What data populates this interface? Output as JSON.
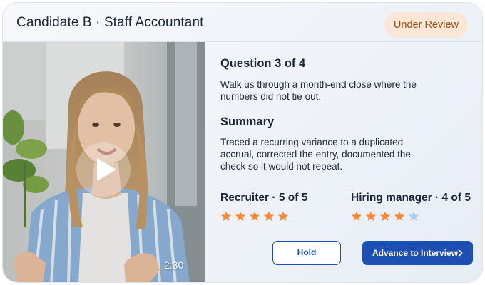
{
  "header": {
    "title": "Candidate B · Staff Accountant",
    "status": "Under Review",
    "status_bg": "#fbe7d7",
    "status_color": "#a24d12"
  },
  "video": {
    "duration": "2:30",
    "play_icon": "play-icon"
  },
  "question": {
    "heading": "Question 3 of 4",
    "text": "Walk us through a month-end close where the numbers did not tie out."
  },
  "summary": {
    "heading": "Summary",
    "text": "Traced a recurring variance to a duplicated accrual, corrected the entry, documented the check so it would not repeat."
  },
  "ratings": {
    "recruiter": {
      "label": "Recruiter · 5 of 5",
      "value": 5,
      "max": 5
    },
    "manager": {
      "label": "Hiring manager · 4 of 5",
      "value": 4,
      "max": 5
    },
    "star_on_color": "#f08a3c",
    "star_off_color": "#a9cdef"
  },
  "actions": {
    "hold_label": "Hold",
    "advance_label": "Advance to Interview",
    "primary_color": "#1d4fb3"
  }
}
